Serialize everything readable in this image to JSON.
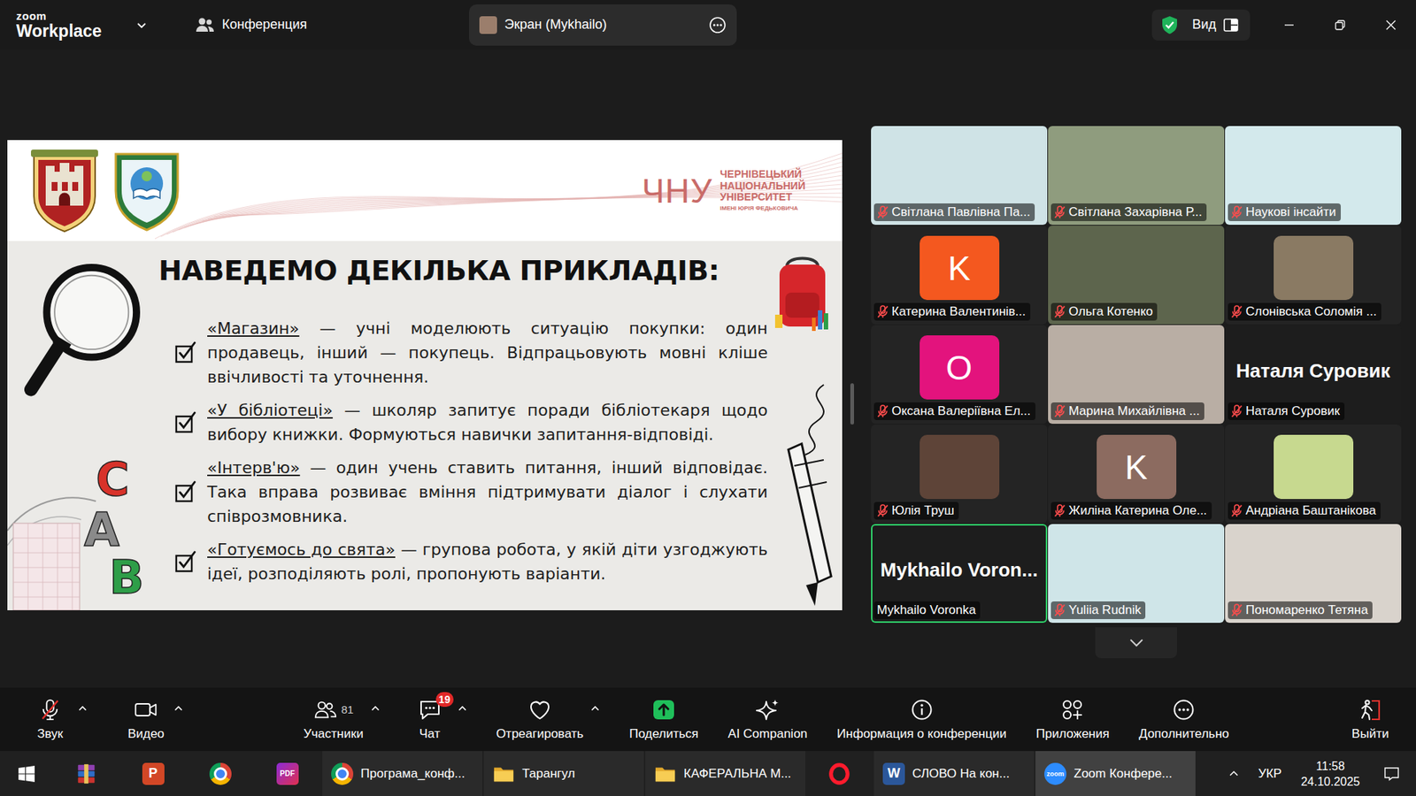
{
  "window": {
    "brand_top": "zoom",
    "brand": "Workplace",
    "tabs": [
      {
        "label": "Конференция",
        "kind": "meeting",
        "selected": false
      },
      {
        "label": "Экран (Mykhailo)",
        "kind": "share",
        "selected": true,
        "color": "#9b7e6c"
      }
    ],
    "secure": true,
    "view_label": "Вид"
  },
  "slide": {
    "university": {
      "mark": "ЧНУ",
      "name": [
        "ЧЕРНІВЕЦЬКИЙ",
        "НАЦІОНАЛЬНИЙ",
        "УНІВЕРСИТЕТ"
      ],
      "sub": "ІМЕНІ ЮРІЯ ФЕДЬКОВИЧА"
    },
    "title": "НАВЕДЕМО ДЕКІЛЬКА ПРИКЛАДІВ:",
    "items": [
      {
        "term": "«Магазин»",
        "text": "— учні моделюють ситуацію покупки: один продавець, інший — покупець. Відпрацьовують мовні кліше ввічливості та уточнення.",
        "checked": true
      },
      {
        "term": "«У бібліотеці»",
        "text": "— школяр запитує поради бібліотекаря щодо вибору книжки. Формуються навички запитання-відповіді.",
        "checked": true
      },
      {
        "term": "«Інтерв'ю»",
        "text": "— один учень ставить питання, інший відповідає. Така вправа розвиває вміння підтримувати діалог і слухати співрозмовника.",
        "checked": true
      },
      {
        "term": "«Готуємось до свята»",
        "text": "— групова робота, у якій діти узгоджують ідеї, розподіляють ролі, пропонують варіанти.",
        "checked": true
      }
    ],
    "blocks": [
      {
        "letter": "C",
        "color": "#d8322a"
      },
      {
        "letter": "A",
        "color": "#8a8a8a"
      },
      {
        "letter": "B",
        "color": "#2e9e48"
      }
    ]
  },
  "gallery": {
    "tiles": [
      {
        "name": "Світлана Павлівна Па...",
        "kind": "video",
        "muted": true,
        "speaking": false,
        "color": "#cfe3e6"
      },
      {
        "name": "Світлана Захарівна Р...",
        "kind": "video",
        "muted": true,
        "speaking": false,
        "color": "#8f9c7e"
      },
      {
        "name": "Наукові інсайти",
        "kind": "video",
        "muted": true,
        "speaking": false,
        "color": "#d3e9ec"
      },
      {
        "name": "Катерина Валентинів...",
        "kind": "avatar",
        "letter": "K",
        "muted": true,
        "speaking": false,
        "color": "#f4581f"
      },
      {
        "name": "Ольга Котенко",
        "kind": "video",
        "muted": true,
        "speaking": false,
        "color": "#5d654d"
      },
      {
        "name": "Слонівська Соломія ...",
        "kind": "picture",
        "muted": true,
        "speaking": false,
        "color": "#8a7a63"
      },
      {
        "name": "Оксана Валеріївна Ел...",
        "kind": "avatar",
        "letter": "O",
        "muted": true,
        "speaking": false,
        "color": "#e3137d"
      },
      {
        "name": "Марина Михайлівна ...",
        "kind": "video",
        "muted": true,
        "speaking": false,
        "color": "#b9aea4"
      },
      {
        "name": "Наталя Суровик",
        "kind": "name",
        "display": "Наталя Суровик",
        "muted": true,
        "speaking": false
      },
      {
        "name": "Юлія Труш",
        "kind": "picture",
        "muted": true,
        "speaking": false,
        "color": "#5e4438"
      },
      {
        "name": "Жиліна Катерина Оле...",
        "kind": "avatar",
        "letter": "K",
        "muted": true,
        "speaking": false,
        "color": "#8c6b60"
      },
      {
        "name": "Андріана Баштанікова",
        "kind": "picture",
        "muted": true,
        "speaking": false,
        "color": "#c7d98f"
      },
      {
        "name": "Mykhailo Voronka",
        "kind": "name",
        "display": "Mykhailo Voron...",
        "muted": false,
        "speaking": true
      },
      {
        "name": "Yuliia Rudnik",
        "kind": "video",
        "muted": true,
        "speaking": false,
        "color": "#cfe5e8"
      },
      {
        "name": "Пономаренко Тетяна",
        "kind": "video",
        "muted": true,
        "speaking": false,
        "color": "#d9d3cc"
      }
    ]
  },
  "toolbar": {
    "left": [
      {
        "label": "Звук",
        "kind": "mic-off",
        "caret": true
      },
      {
        "label": "Видео",
        "kind": "video",
        "caret": true
      }
    ],
    "center": [
      {
        "label": "Участники",
        "kind": "participants",
        "count": "81",
        "caret": true
      },
      {
        "label": "Чат",
        "kind": "chat",
        "badge": "19",
        "caret": true
      },
      {
        "label": "Отреагировать",
        "kind": "react",
        "caret": true
      },
      {
        "label": "Поделиться",
        "kind": "share",
        "caret": false
      },
      {
        "label": "AI Companion",
        "kind": "ai",
        "caret": false
      },
      {
        "label": "Информация о конференции",
        "kind": "info",
        "caret": false
      },
      {
        "label": "Приложения",
        "kind": "apps",
        "caret": false
      },
      {
        "label": "Дополнительно",
        "kind": "more",
        "caret": false
      }
    ],
    "right": [
      {
        "label": "Выйти",
        "kind": "leave",
        "caret": false
      }
    ]
  },
  "taskbar": {
    "items": [
      {
        "kind": "start",
        "selected": false
      },
      {
        "kind": "winrar",
        "selected": false
      },
      {
        "kind": "powerpoint",
        "logo": "P",
        "selected": false
      },
      {
        "kind": "chrome",
        "selected": false
      },
      {
        "kind": "pdf",
        "logo": "PDF",
        "selected": false
      },
      {
        "kind": "chrome",
        "label": "Програма_конф...",
        "selected": false
      },
      {
        "kind": "folder",
        "label": "Тарангул",
        "selected": false
      },
      {
        "kind": "folder",
        "label": "КАФЕРАЛЬНА М...",
        "selected": false
      },
      {
        "kind": "opera",
        "selected": false
      },
      {
        "kind": "word",
        "logo": "W",
        "label": "СЛОВО На кон...",
        "selected": false
      },
      {
        "kind": "zoom",
        "logo": "zoom",
        "label": "Zoom Конфере...",
        "selected": true
      }
    ],
    "tray": {
      "lang": "УКР",
      "time": "11:58",
      "date": "24.10.2025"
    }
  }
}
